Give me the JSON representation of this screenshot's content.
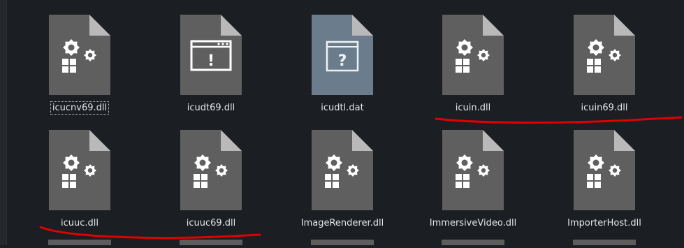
{
  "files": [
    {
      "name": "icucnv69.dll",
      "type": "gear",
      "selected": true
    },
    {
      "name": "icudt69.dll",
      "type": "window",
      "selected": false
    },
    {
      "name": "icudtl.dat",
      "type": "unknown",
      "selected": false
    },
    {
      "name": "icuin.dll",
      "type": "gear",
      "selected": false
    },
    {
      "name": "icuin69.dll",
      "type": "gear",
      "selected": false
    },
    {
      "name": "icuuc.dll",
      "type": "gear",
      "selected": false
    },
    {
      "name": "icuuc69.dll",
      "type": "gear",
      "selected": false
    },
    {
      "name": "ImageRenderer.dll",
      "type": "gear",
      "selected": false
    },
    {
      "name": "ImmersiveVideo.dll",
      "type": "gear",
      "selected": false
    },
    {
      "name": "ImporterHost.dll",
      "type": "gear",
      "selected": false
    }
  ],
  "icon_glyphs": {
    "window": "!",
    "unknown": "?"
  },
  "colors": {
    "background": "#1b1e22",
    "icon_gray": "#5f5f5f",
    "icon_fold": "#b9b9b9",
    "icon_unknown": "#6b7d8d",
    "annotation_red": "#e00000"
  }
}
